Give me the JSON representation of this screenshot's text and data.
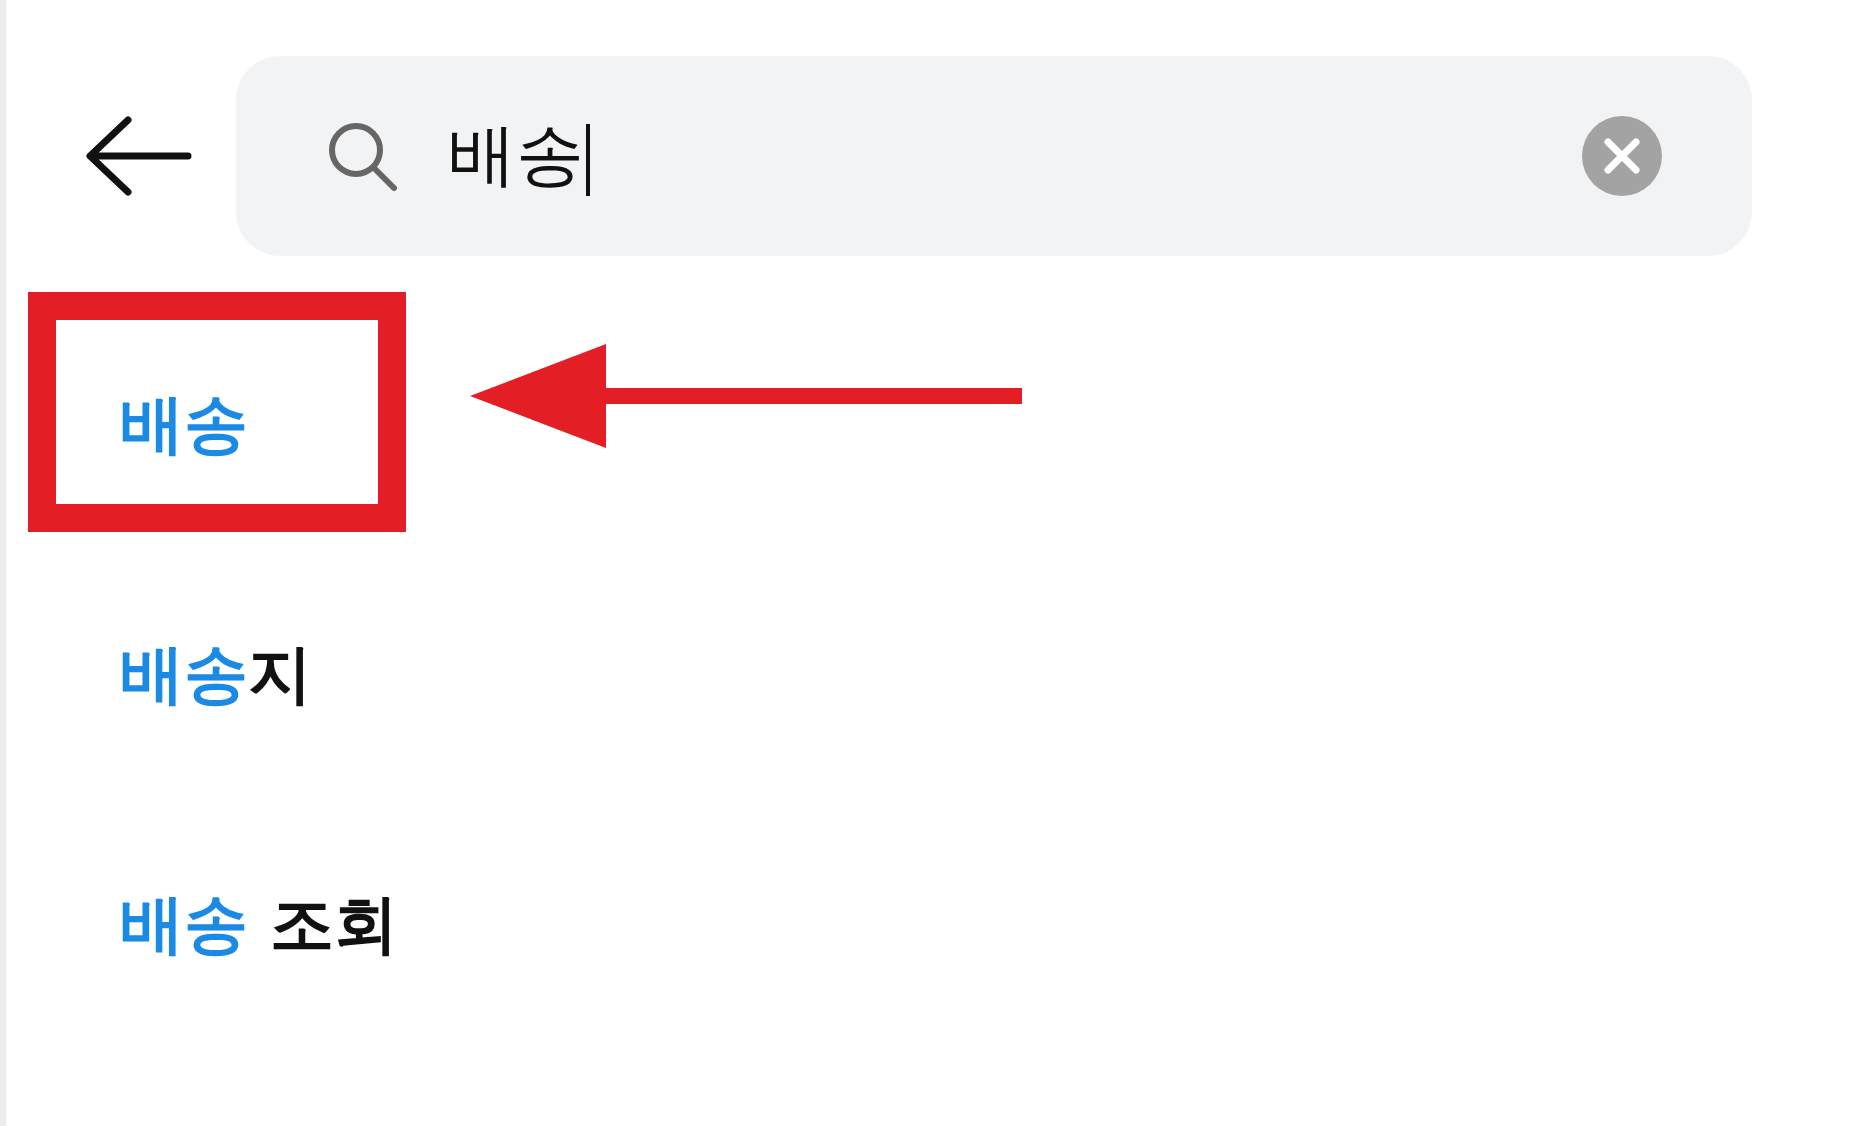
{
  "search": {
    "value": "배송"
  },
  "suggestions": [
    {
      "match": "배송",
      "highlighted": true
    },
    {
      "match": "배송",
      "rest": "지",
      "highlighted": false
    },
    {
      "match": "배송",
      "rest": " 조회",
      "highlighted": false
    }
  ]
}
